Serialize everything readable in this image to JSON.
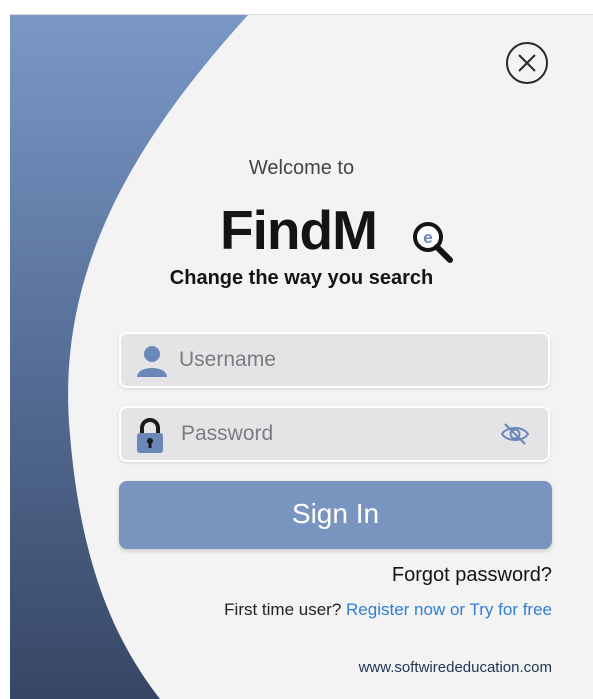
{
  "header": {
    "welcome": "Welcome to",
    "logo_text": "FindM",
    "logo_lens_letter": "e",
    "tagline": "Change the way you search"
  },
  "form": {
    "username_placeholder": "Username",
    "password_placeholder": "Password",
    "signin_label": "Sign In",
    "forgot_label": "Forgot password?",
    "first_time_label": "First time user?",
    "register_label": "Register now or Try for free"
  },
  "footer": {
    "website": "www.softwirededucation.com"
  },
  "icons": {
    "close": "close-icon",
    "user": "user-icon",
    "lock": "lock-icon",
    "password_visibility": "eye-off-icon",
    "logo_magnifier": "magnifier-icon"
  },
  "colors": {
    "accent": "#7995bf",
    "link": "#2f7fd6",
    "panel": "#f3f3f3",
    "side_dark": "#3a4a6a",
    "side_light": "#7a97c6"
  }
}
